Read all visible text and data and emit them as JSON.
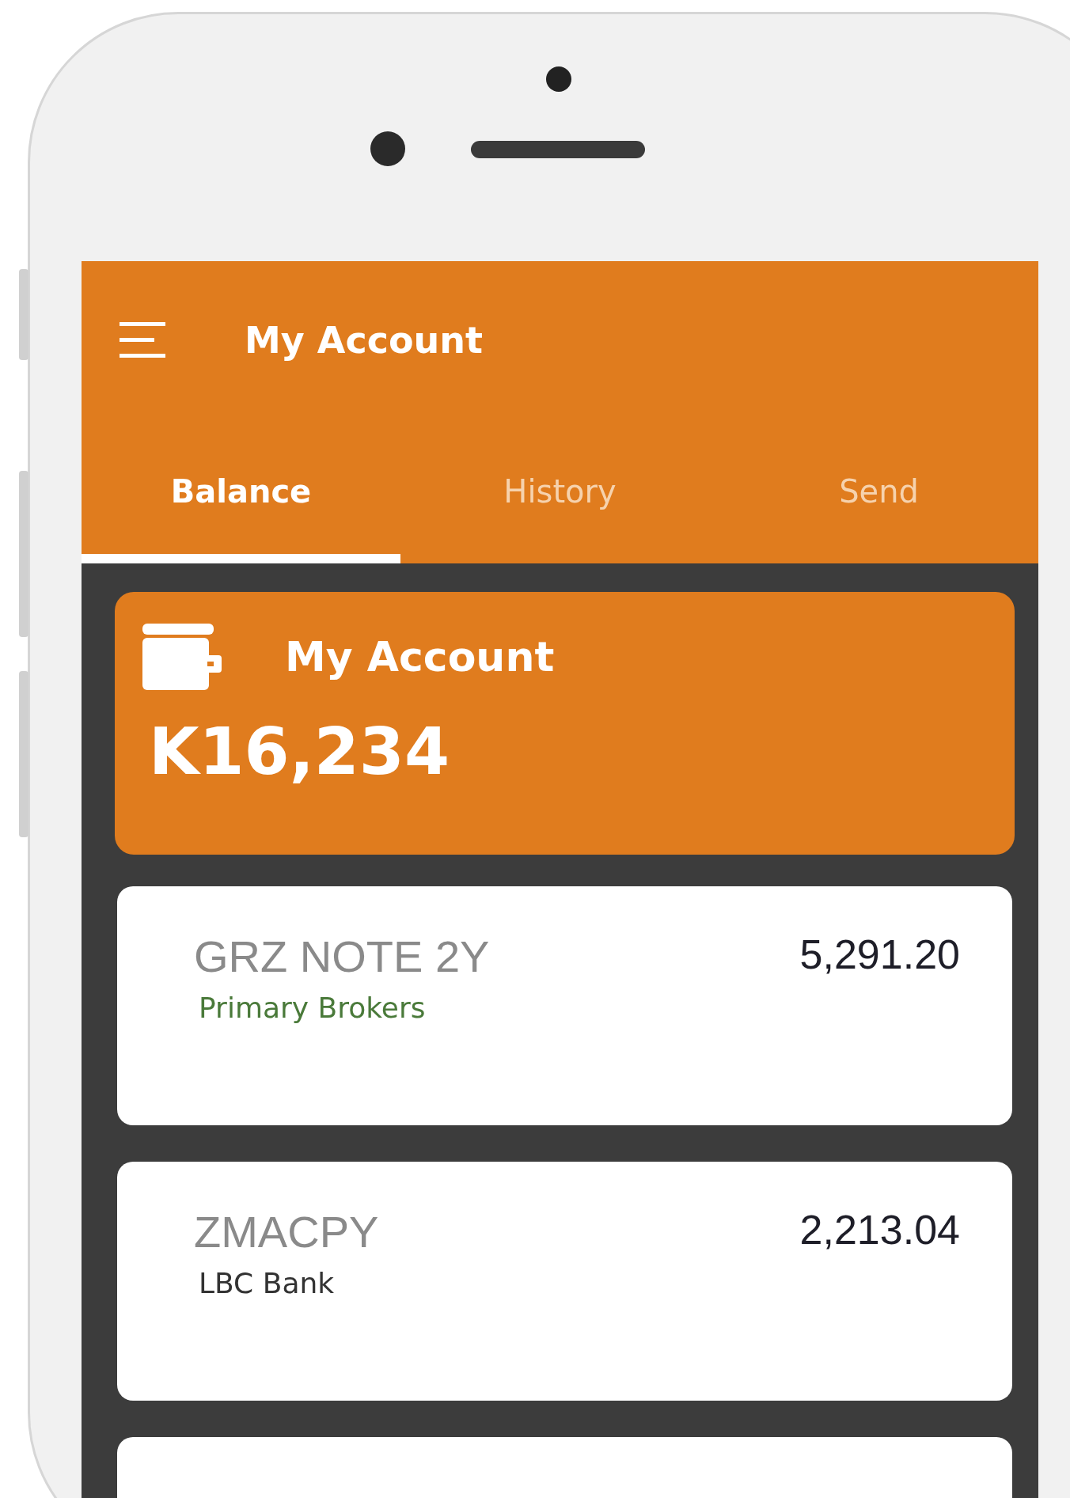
{
  "header": {
    "title": "My Account"
  },
  "tabs": [
    {
      "label": "Balance",
      "selected": true
    },
    {
      "label": "History",
      "selected": false
    },
    {
      "label": "Send",
      "selected": false
    }
  ],
  "balance": {
    "title": "My Account",
    "amount": "K16,234"
  },
  "accounts": [
    {
      "name": "GRZ NOTE 2Y",
      "provider": "Primary Brokers",
      "color": "#4a7a3a",
      "amount": "5,291.20"
    },
    {
      "name": "ZMACPY",
      "provider": "LBC Bank",
      "color": "#333333",
      "amount": "2,213.04"
    }
  ]
}
